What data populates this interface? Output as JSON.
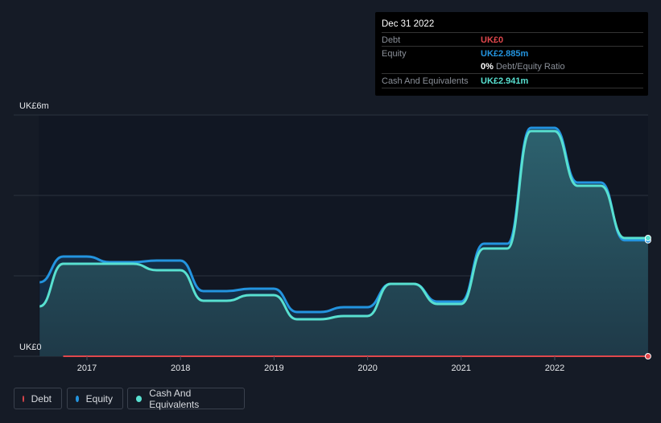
{
  "tooltip": {
    "date": "Dec 31 2022",
    "debt_label": "Debt",
    "debt_value": "UK£0",
    "equity_label": "Equity",
    "equity_value": "UK£2.885m",
    "ratio_value": "0%",
    "ratio_label": "Debt/Equity Ratio",
    "cash_label": "Cash And Equivalents",
    "cash_value": "UK£2.941m"
  },
  "legend": [
    {
      "label": "Debt",
      "color": "#e0474c"
    },
    {
      "label": "Equity",
      "color": "#2394df"
    },
    {
      "label": "Cash And Equivalents",
      "color": "#58e0d0"
    }
  ],
  "chart_data": {
    "type": "area",
    "y_top_label": "UK£6m",
    "y_bottom_label": "UK£0",
    "ylim": [
      0,
      6
    ],
    "yunit": "UK£m",
    "xlim": [
      "2016-01-01",
      "2023-01-01"
    ],
    "x_ticks": [
      "2017",
      "2018",
      "2019",
      "2020",
      "2021",
      "2022"
    ],
    "grid": true,
    "legend_position": "bottom-left",
    "series": [
      {
        "name": "Debt",
        "color": "#e0474c",
        "points": [
          [
            "2016-09-30",
            0
          ],
          [
            "2022-12-31",
            0
          ]
        ]
      },
      {
        "name": "Equity",
        "color": "#2394df",
        "points": [
          [
            "2016-06-30",
            1.84
          ],
          [
            "2016-09-30",
            2.48
          ],
          [
            "2016-12-31",
            2.48
          ],
          [
            "2017-03-31",
            2.34
          ],
          [
            "2017-06-30",
            2.34
          ],
          [
            "2017-09-30",
            2.38
          ],
          [
            "2017-12-31",
            2.38
          ],
          [
            "2018-03-31",
            1.62
          ],
          [
            "2018-06-30",
            1.62
          ],
          [
            "2018-09-30",
            1.68
          ],
          [
            "2018-12-31",
            1.68
          ],
          [
            "2019-03-31",
            1.1
          ],
          [
            "2019-06-30",
            1.1
          ],
          [
            "2019-09-30",
            1.22
          ],
          [
            "2019-12-31",
            1.22
          ],
          [
            "2020-03-31",
            1.8
          ],
          [
            "2020-06-30",
            1.8
          ],
          [
            "2020-09-30",
            1.36
          ],
          [
            "2020-12-31",
            1.36
          ],
          [
            "2021-03-31",
            2.8
          ],
          [
            "2021-06-30",
            2.8
          ],
          [
            "2021-09-30",
            5.68
          ],
          [
            "2021-12-31",
            5.68
          ],
          [
            "2022-03-31",
            4.32
          ],
          [
            "2022-06-30",
            4.32
          ],
          [
            "2022-09-30",
            2.885
          ],
          [
            "2022-12-31",
            2.885
          ]
        ]
      },
      {
        "name": "Cash And Equivalents",
        "color": "#58e0d0",
        "points": [
          [
            "2016-06-30",
            1.24
          ],
          [
            "2016-09-30",
            2.3
          ],
          [
            "2016-12-31",
            2.3
          ],
          [
            "2017-03-31",
            2.3
          ],
          [
            "2017-06-30",
            2.3
          ],
          [
            "2017-09-30",
            2.14
          ],
          [
            "2017-12-31",
            2.14
          ],
          [
            "2018-03-31",
            1.38
          ],
          [
            "2018-06-30",
            1.38
          ],
          [
            "2018-09-30",
            1.52
          ],
          [
            "2018-12-31",
            1.52
          ],
          [
            "2019-03-31",
            0.92
          ],
          [
            "2019-06-30",
            0.92
          ],
          [
            "2019-09-30",
            1.0
          ],
          [
            "2019-12-31",
            1.0
          ],
          [
            "2020-03-31",
            1.8
          ],
          [
            "2020-06-30",
            1.8
          ],
          [
            "2020-09-30",
            1.3
          ],
          [
            "2020-12-31",
            1.3
          ],
          [
            "2021-03-31",
            2.68
          ],
          [
            "2021-06-30",
            2.68
          ],
          [
            "2021-09-30",
            5.6
          ],
          [
            "2021-12-31",
            5.6
          ],
          [
            "2022-03-31",
            4.24
          ],
          [
            "2022-06-30",
            4.24
          ],
          [
            "2022-09-30",
            2.941
          ],
          [
            "2022-12-31",
            2.941
          ]
        ]
      }
    ]
  }
}
